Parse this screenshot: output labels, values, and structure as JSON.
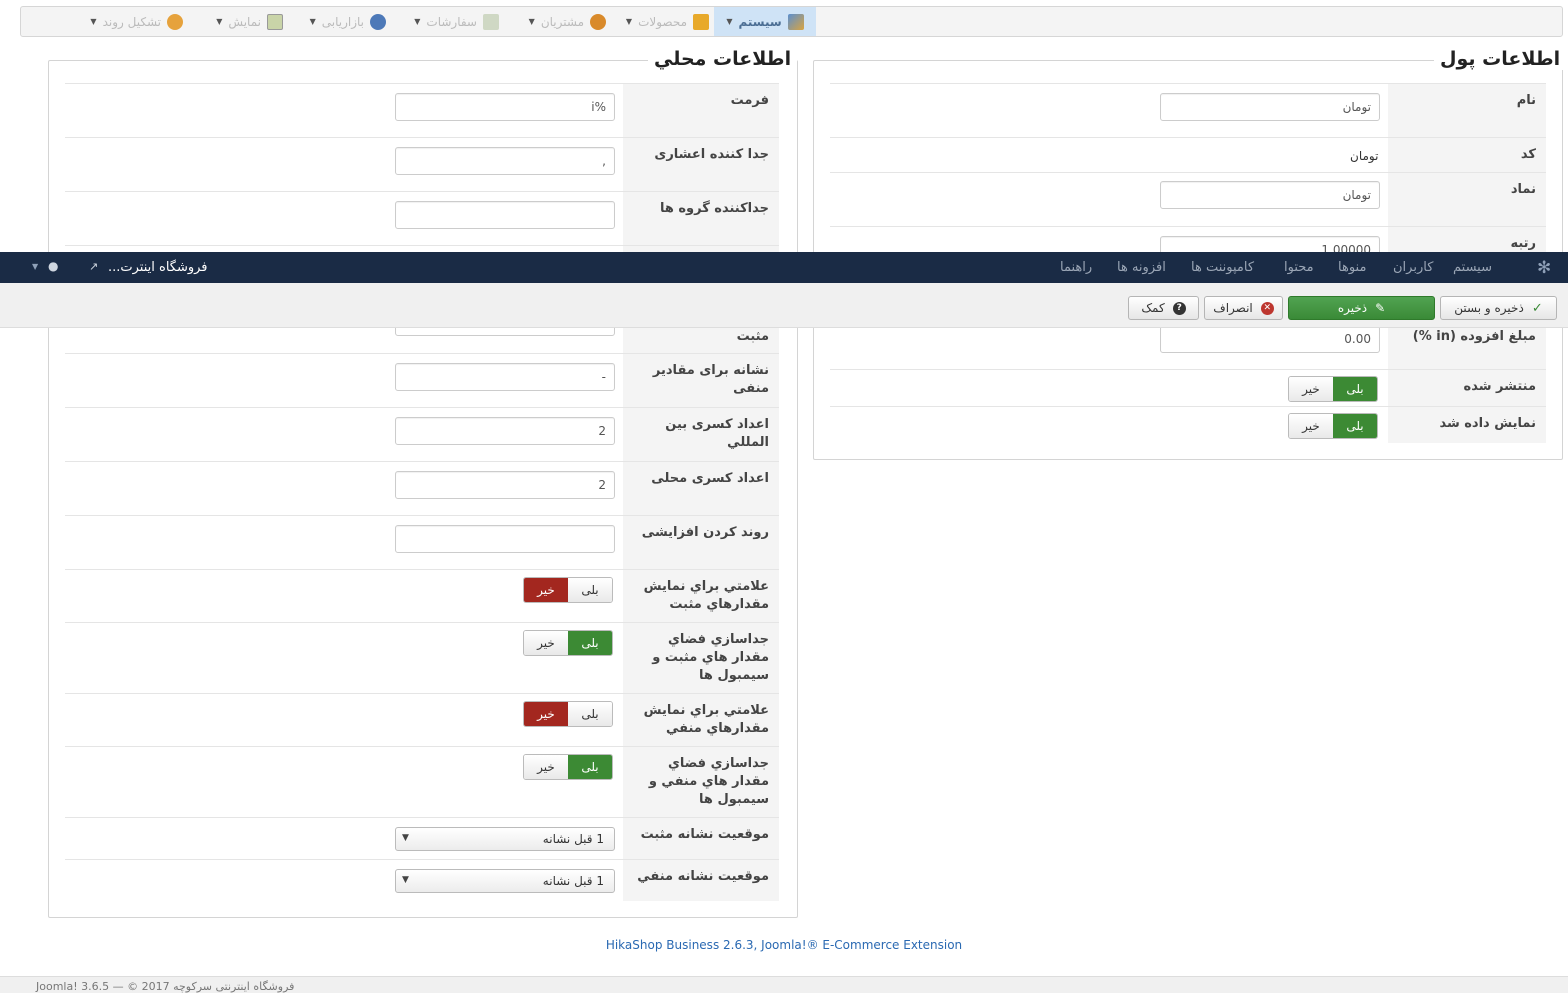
{
  "hikamenu": {
    "items": [
      {
        "label": "سیستم",
        "active": true
      },
      {
        "label": "محصولات"
      },
      {
        "label": "مشتریان"
      },
      {
        "label": "سفارشات"
      },
      {
        "label": "بازاریابی"
      },
      {
        "label": "نمایش"
      },
      {
        "label": "تشکیل روند"
      }
    ]
  },
  "money_info": {
    "legend": "اطلاعات پول",
    "name_label": "نام",
    "name_value": "تومان",
    "code_label": "کد",
    "code_value": "تومان",
    "symbol_label": "نماد",
    "symbol_value": "تومان",
    "rate_label": "رتبه",
    "rate_value": "1.00000",
    "vat_label": "مبلغ افزوده (in %)",
    "vat_value": "0.00",
    "published_label": "منتشر شده",
    "displayed_label": "نمایش داده شد",
    "yes": "بلی",
    "no": "خیر"
  },
  "locale_info": {
    "legend": "اطلاعات محلي",
    "format_label": "فرمت",
    "format_value": "%i",
    "decimal_sep_label": "جدا کننده اعشاری",
    "decimal_sep_value": ",",
    "group_sep_label": "جداکننده گروه ها",
    "group_sep_value": "",
    "positive_tail": "مثبت",
    "negative_sign_label": "نشانه برای مقادیر منفی",
    "negative_sign_value": "-",
    "int_frac_label": "اعداد کسری بین المللي",
    "int_frac_value": "2",
    "local_frac_label": "اعداد کسری محلی",
    "local_frac_value": "2",
    "rounding_label": "روند کردن افزایشی",
    "rounding_value": "",
    "pos_paren_label": "علامتي براي نمايش مقدارهاي مثبت",
    "pos_space_label": "جداسازي فضاي مقدار هاي مثبت و سيمبول ها",
    "neg_paren_label": "علامتي براي نمايش مقدارهاي منفي",
    "neg_space_label": "جداسازي فضاي مقدار هاي منفي و سيمبول ها",
    "pos_sign_pos_label": "موقعيت نشانه مثبت",
    "pos_sign_pos_value": "1 قبل نشانه",
    "neg_sign_pos_label": "موقعيت نشانه منفي",
    "neg_sign_pos_value": "1 قبل نشانه",
    "yes": "بلی",
    "no": "خیر"
  },
  "jnav": {
    "items": [
      "سیستم",
      "کاربران",
      "منوها",
      "محتوا",
      "کامپوننت ها",
      "افزونه ها",
      "راهنما"
    ],
    "site_name": "فروشگاه اینترت..."
  },
  "toolbar": {
    "save_close": "ذخیره و بستن",
    "save": "ذخیره",
    "cancel": "انصراف",
    "help": "کمک"
  },
  "footer": {
    "link": "HikaShop Business 2.6.3, Joomla!® E-Commerce Extension",
    "status": "Joomla! 3.6.5 — © 2017 فروشگاه اینترنتی سرکوچه"
  },
  "colors": {
    "navbar": "#1a2b45",
    "green": "#3c8a34",
    "red": "#a3271f",
    "link": "#2a69b2"
  }
}
